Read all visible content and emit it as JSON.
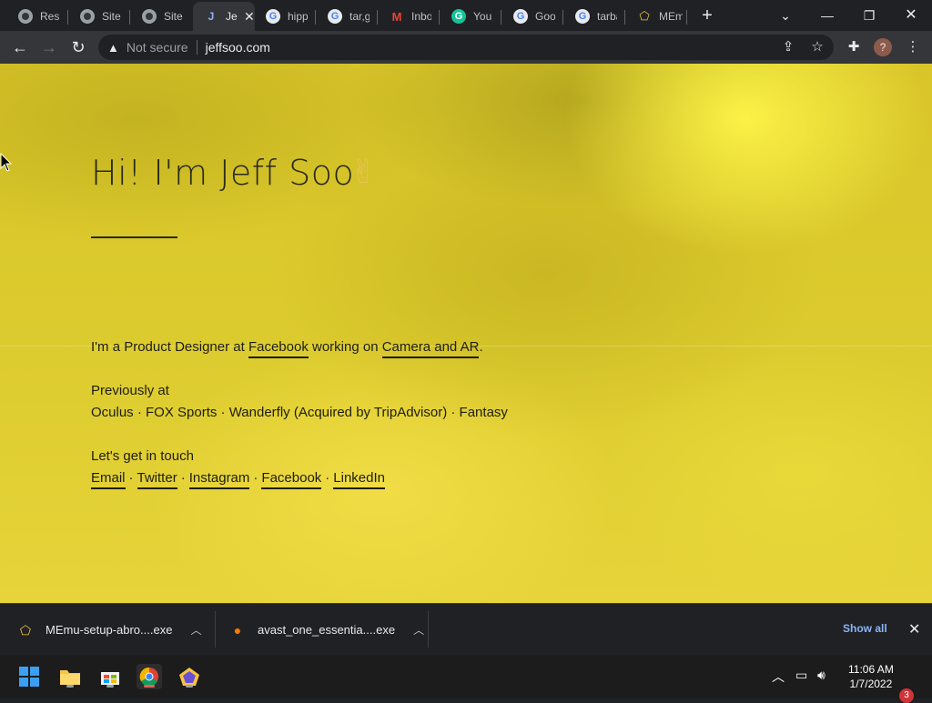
{
  "browser": {
    "tabs": [
      {
        "title": "Resu",
        "favicon": "globe-icon"
      },
      {
        "title": "Site E",
        "favicon": "globe-icon"
      },
      {
        "title": "Site E",
        "favicon": "globe-icon"
      },
      {
        "title": "Je",
        "favicon": "j-icon",
        "active": true
      },
      {
        "title": "hipp",
        "favicon": "google-icon"
      },
      {
        "title": "tar,g",
        "favicon": "google-icon"
      },
      {
        "title": "Inbo",
        "favicon": "gmail-icon"
      },
      {
        "title": "You A",
        "favicon": "grammarly-icon"
      },
      {
        "title": "Goog",
        "favicon": "google-icon"
      },
      {
        "title": "tarba",
        "favicon": "google-icon"
      },
      {
        "title": "MEm",
        "favicon": "memu-icon"
      }
    ],
    "security_label": "Not secure",
    "url": "jeffsoo.com",
    "profile_initial": "?"
  },
  "page": {
    "heading": "Hi! I'm Jeff Soo",
    "intro_prefix": "I'm a Product Designer at ",
    "intro_company": "Facebook",
    "intro_middle": " working on ",
    "intro_team": "Camera and AR",
    "intro_suffix": ".",
    "previously_label": "Previously at",
    "previously_companies": "Oculus · FOX Sports · Wanderfly (Acquired by TripAdvisor) · Fantasy",
    "contact_label": "Let's get in touch",
    "contact_links": [
      "Email",
      "Twitter",
      "Instagram",
      "Facebook",
      "LinkedIn"
    ],
    "contact_separator": "·"
  },
  "downloads": {
    "items": [
      {
        "name": "MEmu-setup-abro....exe",
        "icon": "memu-icon"
      },
      {
        "name": "avast_one_essentia....exe",
        "icon": "avast-icon"
      }
    ],
    "show_all": "Show all"
  },
  "taskbar": {
    "time": "11:06 AM",
    "date": "1/7/2022",
    "notifications": "3"
  },
  "colors": {
    "page_background": "#dccb2e",
    "text": "#1e1e14",
    "chrome_dark": "#202124",
    "toolbar": "#35363a",
    "link_blue": "#8ab4f8"
  }
}
